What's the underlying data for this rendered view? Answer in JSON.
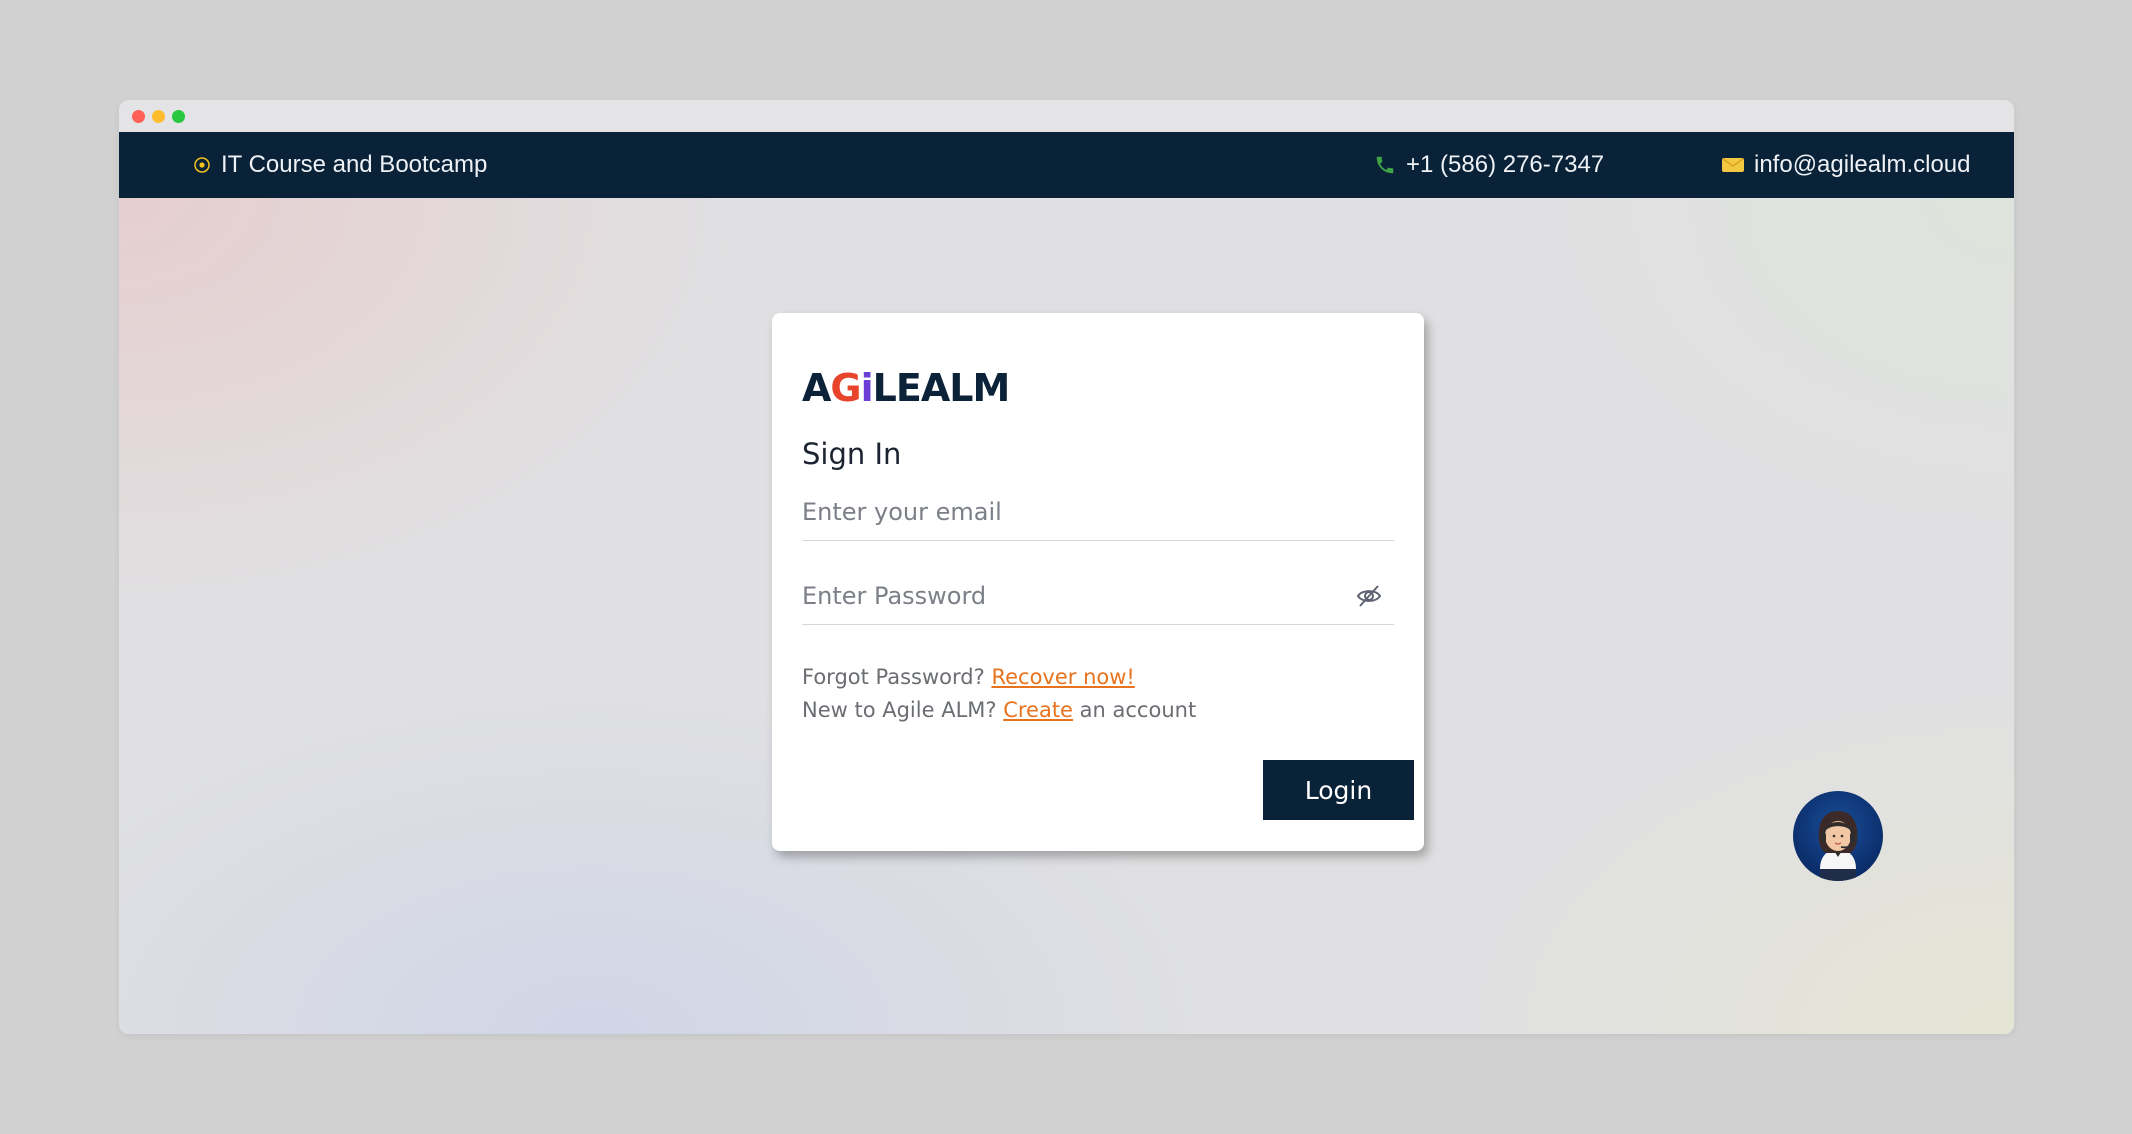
{
  "topbar": {
    "course": "IT Course and Bootcamp",
    "phone": "+1 (586) 276-7347",
    "email": "info@agilealm.cloud"
  },
  "login_card": {
    "logo_text": {
      "a": "A",
      "g": "G",
      "i": "i",
      "rest": "LEALM"
    },
    "title": "Sign In",
    "email_placeholder": "Enter your email",
    "password_placeholder": "Enter Password",
    "forgot_text": "Forgot Password? ",
    "recover_link": "Recover now!",
    "new_text": "New to Agile ALM? ",
    "create_link": "Create",
    "create_suffix": " an account",
    "login_label": "Login"
  },
  "icons": {
    "course": "radio-dot-icon",
    "phone": "phone-icon",
    "mail": "mail-icon",
    "password_toggle": "eye-slash-icon",
    "support": "support-agent-avatar"
  },
  "colors": {
    "navbar": "#0a2238",
    "accent_link": "#e8731e",
    "button": "#0a2238"
  }
}
